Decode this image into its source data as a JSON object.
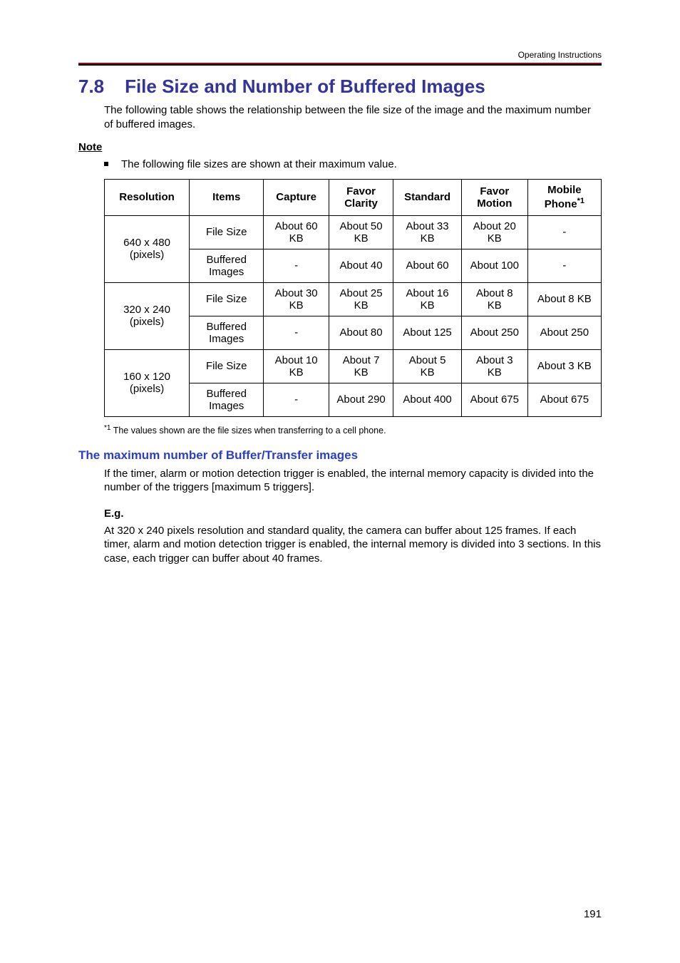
{
  "running_header": "Operating Instructions",
  "section_number": "7.8",
  "section_title": "File Size and Number of Buffered Images",
  "intro_paragraph": "The following table shows the relationship between the file size of the image and the maximum number of buffered images.",
  "note_label": "Note",
  "bullet_items": [
    "The following file sizes are shown at their maximum value."
  ],
  "table": {
    "head": {
      "resolution": "Resolution",
      "items": "Items",
      "capture": "Capture",
      "favor_clarity": "Favor Clarity",
      "standard": "Standard",
      "favor_motion": "Favor Motion",
      "mobile_phone": "Mobile Phone",
      "mobile_phone_sup": "*1"
    },
    "rows": [
      {
        "resolution": "640 x 480 (pixels)",
        "item": "File Size",
        "capture": "About 60 KB",
        "clarity": "About 50 KB",
        "standard": "About 33 KB",
        "motion": "About 20 KB",
        "mobile": "-"
      },
      {
        "resolution": "",
        "item": "Buffered Images",
        "capture": "-",
        "clarity": "About 40",
        "standard": "About 60",
        "motion": "About 100",
        "mobile": "-"
      },
      {
        "resolution": "320 x 240 (pixels)",
        "item": "File Size",
        "capture": "About 30 KB",
        "clarity": "About 25 KB",
        "standard": "About 16 KB",
        "motion": "About 8 KB",
        "mobile": "About 8 KB"
      },
      {
        "resolution": "",
        "item": "Buffered Images",
        "capture": "-",
        "clarity": "About 80",
        "standard": "About 125",
        "motion": "About 250",
        "mobile": "About 250"
      },
      {
        "resolution": "160 x 120 (pixels)",
        "item": "File Size",
        "capture": "About 10 KB",
        "clarity": "About 7 KB",
        "standard": "About 5 KB",
        "motion": "About 3 KB",
        "mobile": "About 3 KB"
      },
      {
        "resolution": "",
        "item": "Buffered Images",
        "capture": "-",
        "clarity": "About 290",
        "standard": "About 400",
        "motion": "About 675",
        "mobile": "About 675"
      }
    ]
  },
  "footnote_sup": "*1",
  "footnote_text": " The values shown are the file sizes when transferring to a cell phone.",
  "subheading": "The maximum number of Buffer/Transfer images",
  "sub_paragraph": "If the timer, alarm or motion detection trigger is enabled, the internal memory capacity is divided into the number of the triggers [maximum 5 triggers].",
  "example_label": "E.g.",
  "example_text": "At 320 x 240 pixels resolution and standard quality, the camera can buffer about 125 frames. If each timer, alarm and motion detection trigger is enabled, the internal memory is divided into 3 sections. In this case, each trigger can buffer about 40 frames.",
  "page_number": "191"
}
